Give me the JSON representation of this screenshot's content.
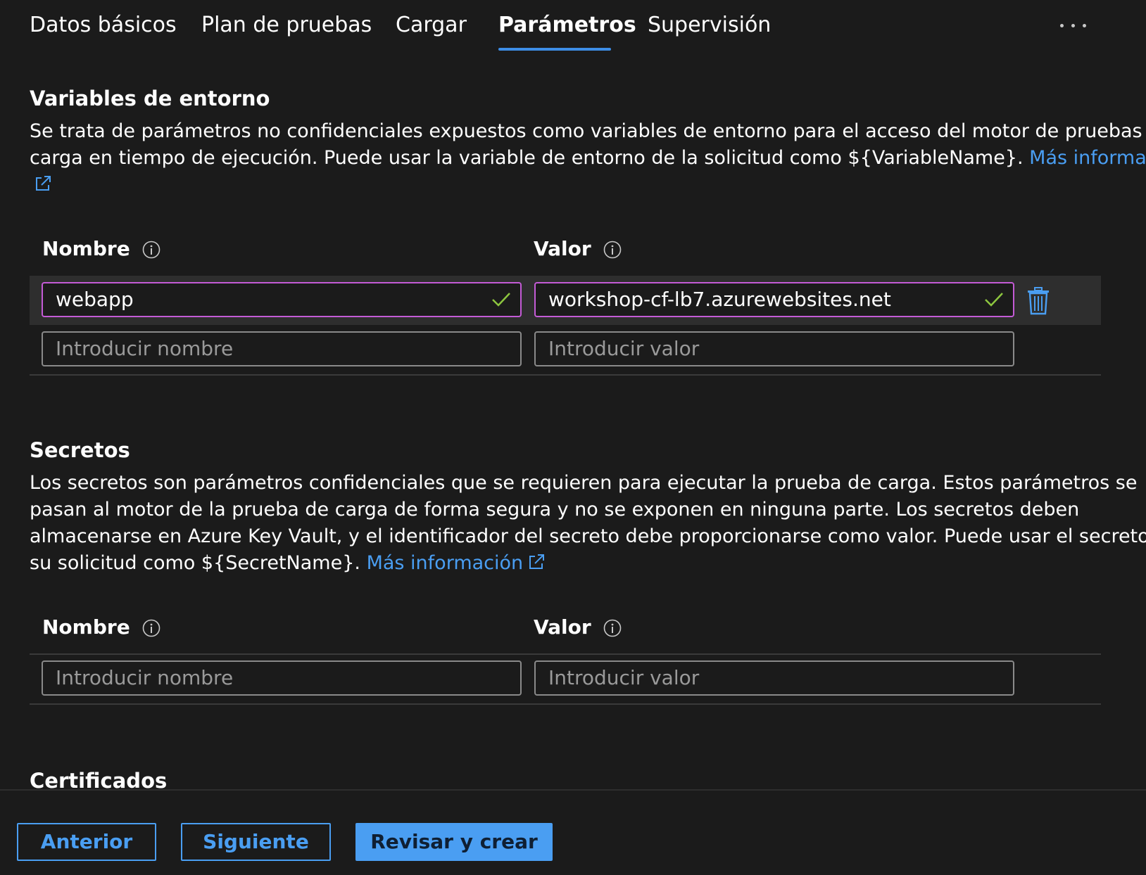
{
  "tabs": [
    {
      "label": "Datos básicos",
      "active": false
    },
    {
      "label": "Plan de pruebas",
      "active": false
    },
    {
      "label": "Cargar",
      "active": false
    },
    {
      "label": "Parámetros",
      "active": true
    },
    {
      "label": "Supervisión",
      "active": false
    }
  ],
  "more_icon": "ellipsis-icon",
  "env": {
    "title": "Variables de entorno",
    "desc_line1": "Se trata de parámetros no confidenciales expuestos como variables de entorno para el acceso del motor de pruebas de",
    "desc_line2": "carga en tiempo de ejecución. Puede usar la variable de entorno de la solicitud como ${VariableName}.",
    "link": "Más información",
    "name_label": "Nombre",
    "value_label": "Valor",
    "rows": [
      {
        "name": "webapp",
        "value": "workshop-cf-lb7.azurewebsites.net"
      }
    ],
    "name_placeholder": "Introducir nombre",
    "value_placeholder": "Introducir valor"
  },
  "secrets": {
    "title": "Secretos",
    "desc_line1": "Los secretos son parámetros confidenciales que se requieren para ejecutar la prueba de carga. Estos parámetros se",
    "desc_line2": "pasan al motor de la prueba de carga de forma segura y no se exponen en ninguna parte. Los secretos deben",
    "desc_line3": "almacenarse en Azure Key Vault, y el identificador del secreto debe proporcionarse como valor. Puede usar el secreto en",
    "desc_line4": "su solicitud como ${SecretName}.",
    "link": "Más información",
    "name_label": "Nombre",
    "value_label": "Valor",
    "name_placeholder": "Introducir nombre",
    "value_placeholder": "Introducir valor"
  },
  "certs": {
    "title": "Certificados"
  },
  "footer": {
    "prev": "Anterior",
    "next": "Siguiente",
    "review": "Revisar y crear"
  },
  "colors": {
    "accent": "#4a9ef2",
    "valid": "#8dc63f",
    "field_focus_border": "#c45bd6"
  }
}
